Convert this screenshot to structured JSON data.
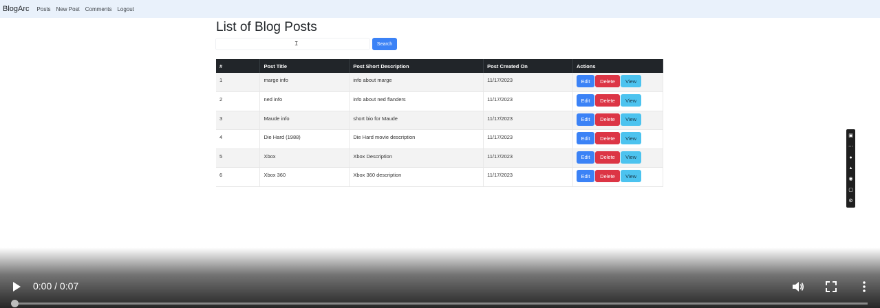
{
  "navbar": {
    "brand": "BlogArc",
    "links": [
      "Posts",
      "New Post",
      "Comments",
      "Logout"
    ]
  },
  "page": {
    "title": "List of Blog Posts"
  },
  "search": {
    "value": "",
    "button_label": "Search"
  },
  "table": {
    "headers": [
      "#",
      "Post Title",
      "Post Short Description",
      "Post Created On",
      "Actions"
    ],
    "rows": [
      [
        "1",
        "marge info",
        "info about marge",
        "11/17/2023"
      ],
      [
        "2",
        "ned info",
        "info about ned flanders",
        "11/17/2023"
      ],
      [
        "3",
        "Maude info",
        "short bio for Maude",
        "11/17/2023"
      ],
      [
        "4",
        "Die Hard (1988)",
        "Die Hard movie description",
        "11/17/2023"
      ],
      [
        "5",
        "Xbox",
        "Xbox Description",
        "11/17/2023"
      ],
      [
        "6",
        "Xbox 360",
        "Xbox 360 description",
        "11/17/2023"
      ]
    ],
    "actions": {
      "edit": "Edit",
      "delete": "Delete",
      "view": "View"
    }
  },
  "side_tools": [
    "camera-icon",
    "more-icon",
    "mic-icon",
    "volume-icon",
    "webcam-icon",
    "pages-icon",
    "settings-icon"
  ],
  "video": {
    "time": "0:00 / 0:07",
    "progress": 0
  },
  "colors": {
    "navbar_bg": "#e9f1fb",
    "primary": "#3b82f6",
    "danger": "#dc3545",
    "info": "#4cc3ef",
    "table_header": "#212529"
  }
}
